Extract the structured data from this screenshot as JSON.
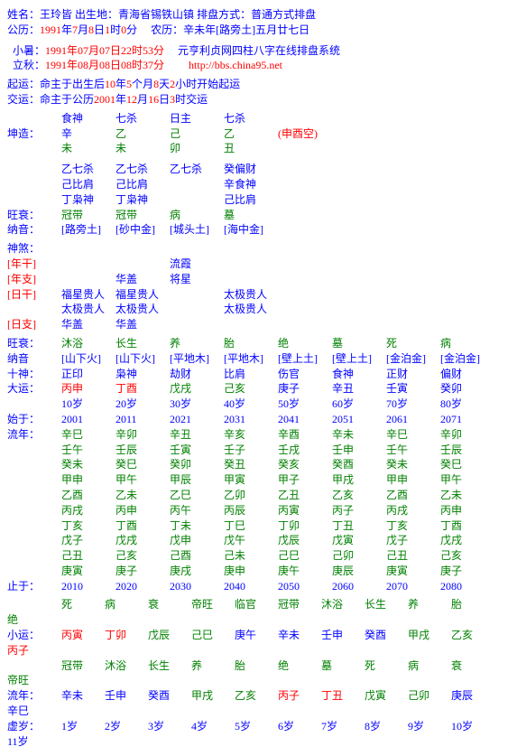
{
  "hdr": {
    "l1a": "姓名：",
    "l1av": "王玲皆",
    "l1b": "    出生地：",
    "l1bv": "青海省锡铁山镇",
    "l1c": "    排盘方式：",
    "l1cv": "普通方式排盘",
    "l2a": "公历：",
    "l2y": "1991",
    "l2yt": "年",
    "l2m": "7",
    "l2mt": "月",
    "l2d": "8",
    "l2dt": "日",
    "l2h": "1",
    "l2ht": "时",
    "l2mi": "0",
    "l2mit": "分",
    "l2sp": "     ",
    "l2nl": "农历：",
    "l2nv": "辛未年[路旁土]五月廿七日",
    "l3a": "  小暑：",
    "l3v": "1991年07月07日22时53分",
    "l3sp": "     ",
    "l3sys": "元亨利贞网四柱八字在线排盘系统",
    "l4a": "  立秋：",
    "l4v": "1991年08月08日08时37分",
    "l4sp": "         ",
    "l4url": "http://bbs.china95.net",
    "qy": {
      "a": "起运：",
      "b": "命主于出生后",
      "c": "10",
      "d": "年",
      "e": "5",
      "f": "个月",
      "g": "8",
      "h": "天",
      "i": "2",
      "j": "小时开始起运"
    },
    "jy": {
      "a": "交运：",
      "b": "命主于公历",
      "c": "2001",
      "d": "年",
      "e": "12",
      "f": "月",
      "g": "16",
      "h": "日",
      "i": "3",
      "j": "时交运"
    }
  },
  "pillars": {
    "hdr": [
      "食神",
      "七杀",
      "日主",
      "七杀"
    ],
    "kun": "坤造：",
    "gan": [
      "辛",
      "乙",
      "己",
      "乙"
    ],
    "kong": "(申酉空)",
    "zhi": [
      "未",
      "未",
      "卯",
      "丑"
    ],
    "hid": [
      [
        "乙七杀",
        "己比肩",
        "丁枭神"
      ],
      [
        "乙七杀",
        "己比肩",
        "丁枭神"
      ],
      [
        "乙七杀",
        "",
        "　"
      ],
      [
        "癸偏财",
        "辛食神",
        "己比肩"
      ]
    ],
    "ws": "旺衰：",
    "wsv": [
      "冠带",
      "冠带",
      "病",
      "墓"
    ],
    "ny": "纳音：",
    "nyv": [
      "[路旁土]",
      "[砂中金]",
      "[城头土]",
      "[海中金]"
    ]
  },
  "shensha": {
    "t": "神煞：",
    "rows": [
      [
        "[年干]",
        "",
        "",
        "流霞",
        ""
      ],
      [
        "[年支]",
        "",
        "华盖",
        "将星",
        ""
      ],
      [
        "[日干]",
        "福星贵人",
        "福星贵人",
        "",
        "太极贵人"
      ],
      [
        "",
        "太极贵人",
        "太极贵人",
        "",
        "太极贵人"
      ],
      [
        "[日支]",
        "华盖",
        "华盖",
        "",
        ""
      ]
    ]
  },
  "dayun": {
    "ws": "旺衰：",
    "wsv": [
      "沐浴",
      "长生",
      "养",
      "胎",
      "绝",
      "墓",
      "死",
      "病"
    ],
    "ny": "纳音",
    "nyv": [
      "[山下火]",
      "[山下火]",
      "[平地木]",
      "[平地木]",
      "[壁上土]",
      "[壁上土]",
      "[金泊金]",
      "[金泊金]"
    ],
    "ss": "十神：",
    "ssv": [
      "正印",
      "枭神",
      "劫财",
      "比肩",
      "伤官",
      "食神",
      "正财",
      "偏财"
    ],
    "dy": "大运：",
    "dyv": [
      "丙申",
      "丁酉",
      "戊戌",
      "己亥",
      "庚子",
      "辛丑",
      "壬寅",
      "癸卯"
    ],
    "age": [
      "10岁",
      "20岁",
      "30岁",
      "40岁",
      "50岁",
      "60岁",
      "70岁",
      "80岁"
    ],
    "sy": "始于：",
    "syv": [
      "2001",
      "2011",
      "2021",
      "2031",
      "2041",
      "2051",
      "2061",
      "2071"
    ],
    "ln": "流年：",
    "lnrows": [
      [
        "辛巳",
        "辛卯",
        "辛丑",
        "辛亥",
        "辛酉",
        "辛未",
        "辛巳",
        "辛卯"
      ],
      [
        "壬午",
        "壬辰",
        "壬寅",
        "壬子",
        "壬戌",
        "壬申",
        "壬午",
        "壬辰"
      ],
      [
        "癸未",
        "癸巳",
        "癸卯",
        "癸丑",
        "癸亥",
        "癸酉",
        "癸未",
        "癸巳"
      ],
      [
        "甲申",
        "甲午",
        "甲辰",
        "甲寅",
        "甲子",
        "甲戌",
        "甲申",
        "甲午"
      ],
      [
        "乙酉",
        "乙未",
        "乙巳",
        "乙卯",
        "乙丑",
        "乙亥",
        "乙酉",
        "乙未"
      ],
      [
        "丙戌",
        "丙申",
        "丙午",
        "丙辰",
        "丙寅",
        "丙子",
        "丙戌",
        "丙申"
      ],
      [
        "丁亥",
        "丁酉",
        "丁未",
        "丁巳",
        "丁卯",
        "丁丑",
        "丁亥",
        "丁酉"
      ],
      [
        "戊子",
        "戊戌",
        "戊申",
        "戊午",
        "戊辰",
        "戊寅",
        "戊子",
        "戊戌"
      ],
      [
        "己丑",
        "己亥",
        "己酉",
        "己未",
        "己巳",
        "己卯",
        "己丑",
        "己亥"
      ],
      [
        "庚寅",
        "庚子",
        "庚戌",
        "庚申",
        "庚午",
        "庚辰",
        "庚寅",
        "庚子"
      ]
    ],
    "zy": "止于：",
    "zyv": [
      "2010",
      "2020",
      "2030",
      "2040",
      "2050",
      "2060",
      "2070",
      "2080"
    ]
  },
  "xiaoyun": {
    "wsv": [
      "死",
      "病",
      "衰",
      "帝旺",
      "临官",
      "冠带",
      "沐浴",
      "长生",
      "养",
      "胎",
      "绝"
    ],
    "xy": "小运：",
    "xyv": [
      "丙寅",
      "丁卯",
      "戊辰",
      "己巳",
      "庚午",
      "辛未",
      "壬申",
      "癸酉",
      "甲戌",
      "乙亥",
      "丙子"
    ],
    "wsv2": [
      "冠带",
      "沐浴",
      "长生",
      "养",
      "胎",
      "绝",
      "墓",
      "死",
      "病",
      "衰",
      "帝旺"
    ],
    "ln": "流年：",
    "lnv": [
      "辛未",
      "壬申",
      "癸酉",
      "甲戌",
      "乙亥",
      "丙子",
      "丁丑",
      "戊寅",
      "己卯",
      "庚辰",
      "辛巳"
    ],
    "xs": "虚岁：",
    "xsv": [
      "1岁",
      "2岁",
      "3岁",
      "4岁",
      "5岁",
      "6岁",
      "7岁",
      "8岁",
      "9岁",
      "10岁",
      "11岁"
    ]
  }
}
